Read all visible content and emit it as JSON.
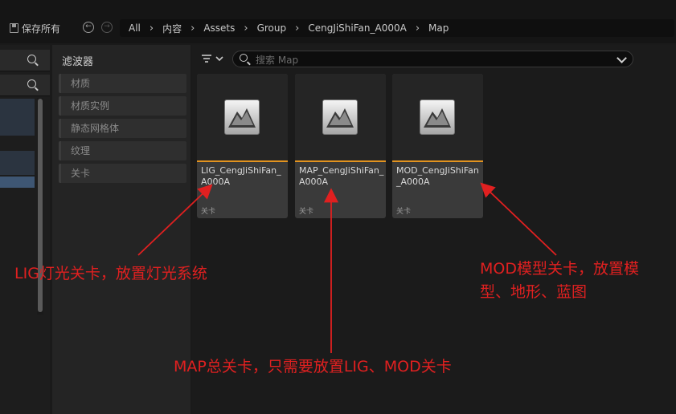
{
  "toolbar": {
    "save_all_label": "保存所有"
  },
  "breadcrumb": [
    "All",
    "内容",
    "Assets",
    "Group",
    "CengJiShiFan_A000A",
    "Map"
  ],
  "filters": {
    "title": "滤波器",
    "items": [
      "材质",
      "材质实例",
      "静态网格体",
      "纹理",
      "关卡"
    ]
  },
  "search": {
    "placeholder": "搜索 Map"
  },
  "assets": [
    {
      "name": "LIG_CengJiShiFan_A000A",
      "type": "关卡"
    },
    {
      "name": "MAP_CengJiShiFan_A000A",
      "type": "关卡"
    },
    {
      "name": "MOD_CengJiShiFan_A000A",
      "type": "关卡"
    }
  ],
  "annotations": {
    "lig": "LIG灯光关卡，放置灯光系统",
    "mod_line1": "MOD模型关卡，放置模",
    "mod_line2": "型、地形、蓝图",
    "map": "MAP总关卡，只需要放置LIG、MOD关卡"
  },
  "colors": {
    "annotation": "#e02020",
    "asset_accent": "#e2931f"
  }
}
